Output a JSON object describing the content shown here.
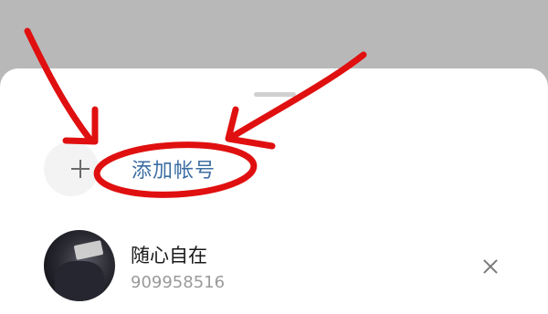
{
  "sheet": {
    "add_account": {
      "icon": "plus-icon",
      "label": "添加帐号"
    },
    "accounts": [
      {
        "name": "随心自在",
        "id": "909958516",
        "avatar": "avatar-photo",
        "remove_icon": "close-icon"
      }
    ]
  },
  "annotation": {
    "color": "#e01010",
    "shapes": [
      "arrow-to-plus",
      "arrow-to-label",
      "ellipse-around-label"
    ]
  }
}
